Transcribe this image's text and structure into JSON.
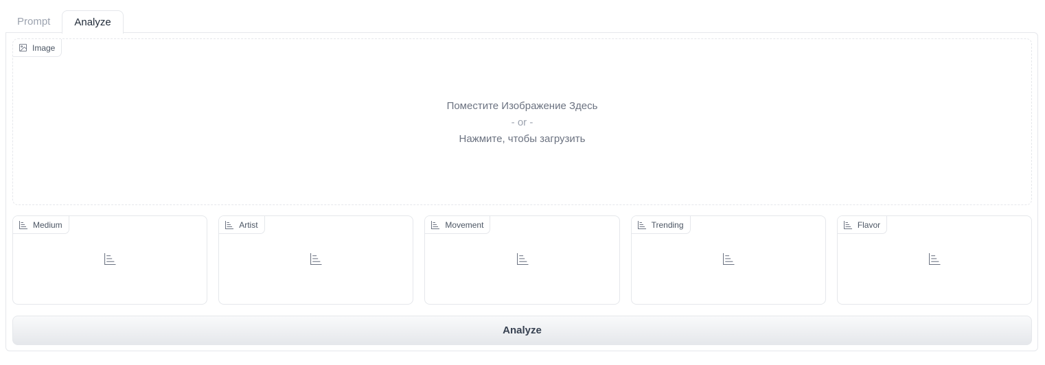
{
  "tabs": [
    {
      "label": "Prompt",
      "active": false
    },
    {
      "label": "Analyze",
      "active": true
    }
  ],
  "image_input": {
    "label": "Image",
    "icon": "image-icon",
    "drop_text": "Поместите Изображение Здесь",
    "or_text": "- or -",
    "click_text": "Нажмите, чтобы загрузить"
  },
  "cards": [
    {
      "label": "Medium",
      "icon": "bar-chart-icon"
    },
    {
      "label": "Artist",
      "icon": "bar-chart-icon"
    },
    {
      "label": "Movement",
      "icon": "bar-chart-icon"
    },
    {
      "label": "Trending",
      "icon": "bar-chart-icon"
    },
    {
      "label": "Flavor",
      "icon": "bar-chart-icon"
    }
  ],
  "analyze_button": {
    "label": "Analyze"
  },
  "colors": {
    "border": "#e5e7eb",
    "text": "#374151",
    "muted": "#9ca3af",
    "button_top": "#f9fafb",
    "button_bottom": "#e5e7eb"
  }
}
